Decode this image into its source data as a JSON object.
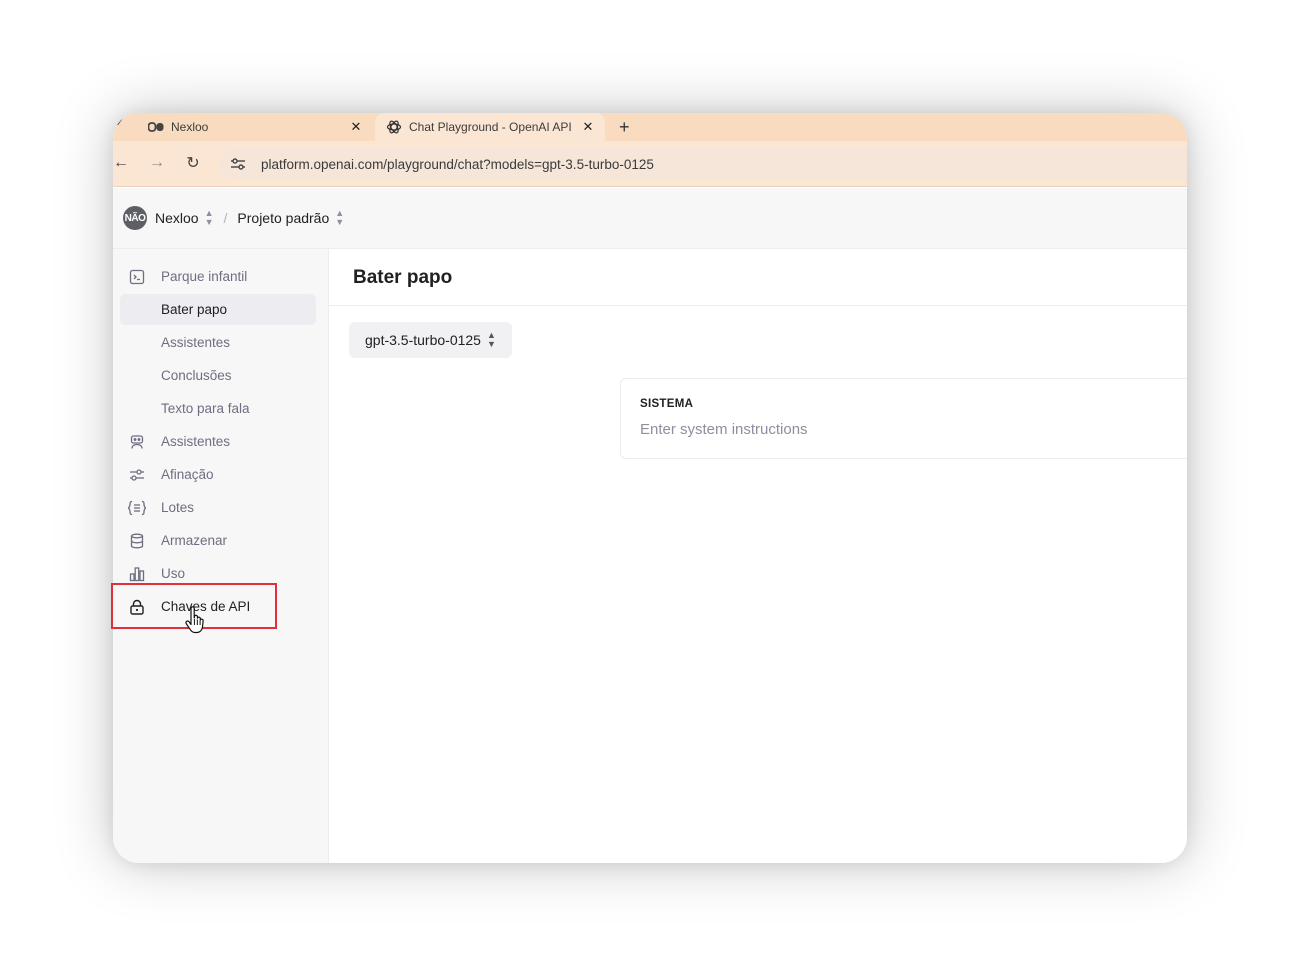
{
  "browser": {
    "tabs": [
      {
        "title": "Nexloo",
        "favicon": "nexloo-logo-icon",
        "active": false
      },
      {
        "title": "Chat Playground - OpenAI API",
        "favicon": "openai-logo-icon",
        "active": true
      }
    ],
    "url": "platform.openai.com/playground/chat?models=gpt-3.5-turbo-0125"
  },
  "header": {
    "avatar_text": "NÃO",
    "org": "Nexloo",
    "separator": "/",
    "project": "Projeto padrão"
  },
  "sidebar": {
    "items": [
      {
        "label": "Parque infantil",
        "icon": "terminal-icon"
      },
      {
        "label": "Bater papo",
        "selected": true
      },
      {
        "label": "Assistentes"
      },
      {
        "label": "Conclusões"
      },
      {
        "label": "Texto para fala"
      },
      {
        "label": "Assistentes",
        "icon": "robot-icon"
      },
      {
        "label": "Afinação",
        "icon": "sliders-icon"
      },
      {
        "label": "Lotes",
        "icon": "braces-list-icon"
      },
      {
        "label": "Armazenar",
        "icon": "database-icon"
      },
      {
        "label": "Uso",
        "icon": "bar-chart-icon"
      },
      {
        "label": "Chaves de API",
        "icon": "lock-icon"
      }
    ]
  },
  "main": {
    "title": "Bater papo",
    "model": "gpt-3.5-turbo-0125",
    "system": {
      "label": "SISTEMA",
      "placeholder": "Enter system instructions"
    }
  },
  "colors": {
    "tabstrip": "#f9dcc0",
    "highlight": "#e0303a",
    "sidebar_bg": "#f7f7f8"
  }
}
